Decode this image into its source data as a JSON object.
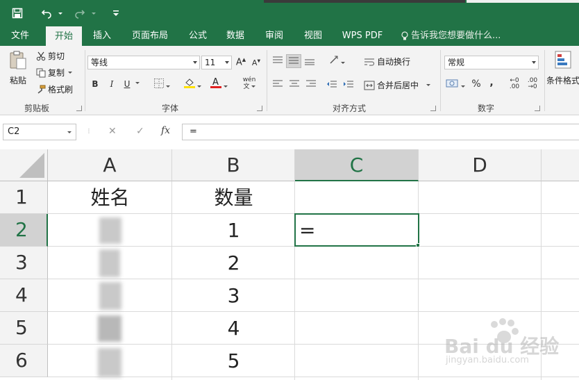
{
  "qat": {
    "save_icon": "save-icon",
    "undo_icon": "undo-icon",
    "redo_icon": "redo-icon",
    "customize_icon": "customize-qat-icon"
  },
  "tabs": [
    {
      "label": "文件",
      "active": false
    },
    {
      "label": "开始",
      "active": true
    },
    {
      "label": "插入",
      "active": false
    },
    {
      "label": "页面布局",
      "active": false
    },
    {
      "label": "公式",
      "active": false
    },
    {
      "label": "数据",
      "active": false
    },
    {
      "label": "审阅",
      "active": false
    },
    {
      "label": "视图",
      "active": false
    },
    {
      "label": "WPS PDF",
      "active": false
    }
  ],
  "tell_me": "告诉我您想要做什么...",
  "clipboard": {
    "paste": "粘贴",
    "cut": "剪切",
    "copy": "复制",
    "format_painter": "格式刷",
    "group": "剪贴板"
  },
  "font": {
    "name": "等线",
    "size": "11",
    "bold": "B",
    "italic": "I",
    "underline": "U",
    "grow": "A",
    "shrink": "A",
    "color": "A",
    "phonetic": "wén",
    "group": "字体"
  },
  "alignment": {
    "wrap": "自动换行",
    "merge": "合并后居中",
    "group": "对齐方式"
  },
  "number": {
    "format": "常规",
    "percent": "%",
    "comma": ",",
    "inc_decimal": ".00",
    "dec_decimal": ".00",
    "group": "数字"
  },
  "styles": {
    "conditional": "条件格式"
  },
  "formula_bar": {
    "name_box": "C2",
    "cancel": "✕",
    "enter": "✓",
    "fx": "fx",
    "content": "="
  },
  "columns": [
    "A",
    "B",
    "C",
    "D"
  ],
  "selected_column": "C",
  "rows": [
    {
      "num": "1",
      "a": "",
      "b": "数量",
      "c": ""
    },
    {
      "num": "2",
      "a": "",
      "b": "1",
      "c": "="
    },
    {
      "num": "3",
      "a": "",
      "b": "2",
      "c": ""
    },
    {
      "num": "4",
      "a": "",
      "b": "3",
      "c": ""
    },
    {
      "num": "5",
      "a": "",
      "b": "4",
      "c": ""
    },
    {
      "num": "6",
      "a": "",
      "b": "5",
      "c": ""
    }
  ],
  "header_a1": "姓名",
  "selected_row": "2",
  "watermark": {
    "brand": "Bai du 经验",
    "url": "jingyan.baidu.com"
  },
  "colors": {
    "accent": "#217346",
    "ribbon": "#f3f3f3",
    "header": "#f3f3f3",
    "selected_header": "#d2d2d2"
  }
}
